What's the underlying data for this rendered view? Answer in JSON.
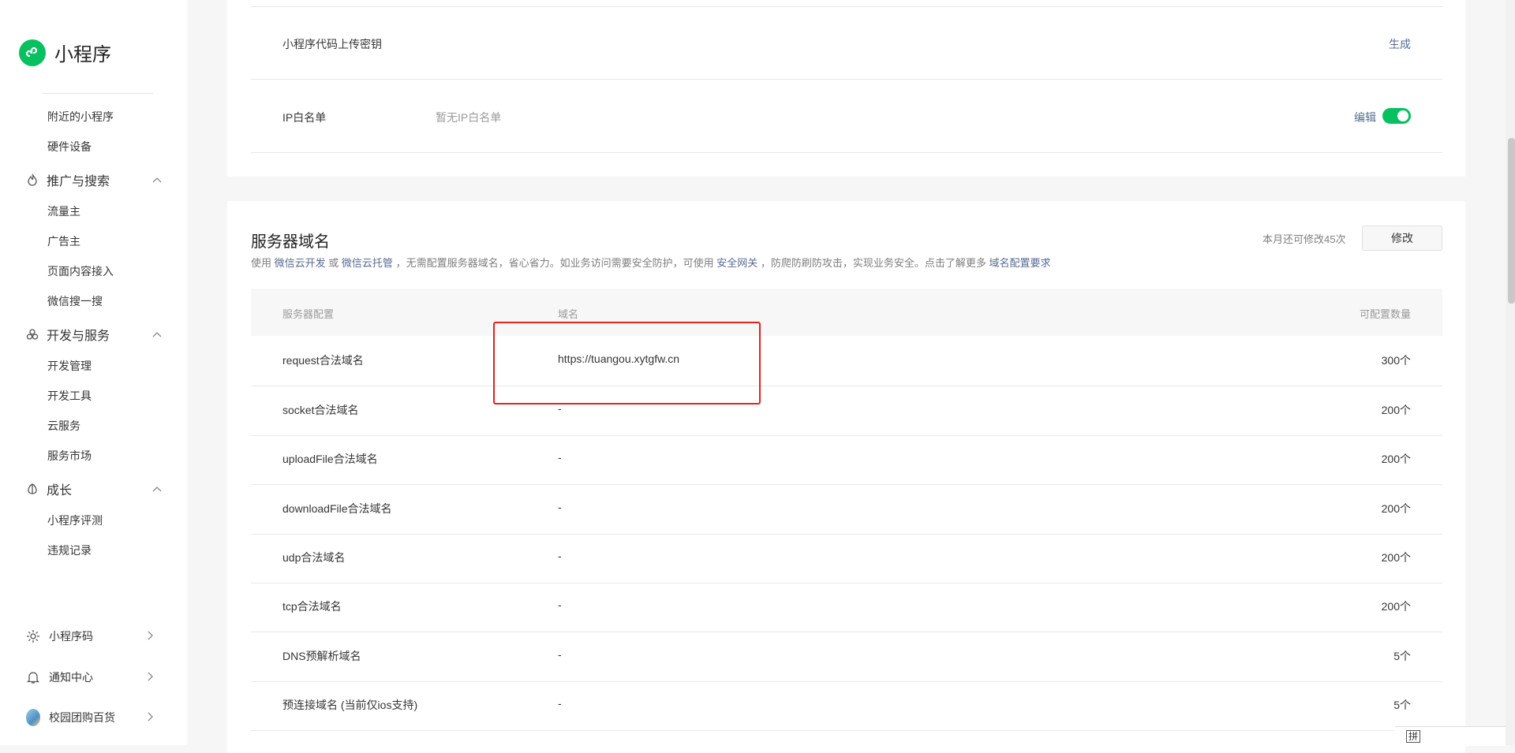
{
  "app": {
    "title": "小程序"
  },
  "sidebar": {
    "items": [
      {
        "label": "附近的小程序"
      },
      {
        "label": "硬件设备"
      },
      {
        "label": "推广与搜索"
      },
      {
        "label": "流量主"
      },
      {
        "label": "广告主"
      },
      {
        "label": "页面内容接入"
      },
      {
        "label": "微信搜一搜"
      },
      {
        "label": "开发与服务"
      },
      {
        "label": "开发管理"
      },
      {
        "label": "开发工具"
      },
      {
        "label": "云服务"
      },
      {
        "label": "服务市场"
      },
      {
        "label": "成长"
      },
      {
        "label": "小程序评测"
      },
      {
        "label": "违规记录"
      }
    ],
    "bottom": [
      {
        "label": "小程序码",
        "icon": "sun-icon"
      },
      {
        "label": "通知中心",
        "icon": "bell-icon"
      },
      {
        "label": "校园团购百货",
        "icon": "avatar"
      }
    ]
  },
  "top_card": {
    "upload_key": {
      "label": "小程序代码上传密钥",
      "action": "生成"
    },
    "ip_whitelist": {
      "label": "IP白名单",
      "note": "暂无IP白名单",
      "action": "编辑",
      "enabled": true
    }
  },
  "server_domain": {
    "title": "服务器域名",
    "desc": {
      "p1": "使用",
      "link1": "微信云开发",
      "p2": "或",
      "link2": "微信云托管",
      "p3": "，无需配置服务器域名，省心省力。如业务访问需要安全防护，可使用",
      "link3": "安全网关",
      "p4": "，防爬防刷防攻击，实现业务安全。点击了解更多",
      "link4": "域名配置要求"
    },
    "quota": "本月还可修改45次",
    "modify_label": "修改",
    "headers": [
      "服务器配置",
      "域名",
      "可配置数量"
    ],
    "rows": [
      {
        "config": "request合法域名",
        "domain": "https://tuangou.xytgfw.cn",
        "count": "300个"
      },
      {
        "config": "socket合法域名",
        "domain": "-",
        "count": "200个"
      },
      {
        "config": "uploadFile合法域名",
        "domain": "-",
        "count": "200个"
      },
      {
        "config": "downloadFile合法域名",
        "domain": "-",
        "count": "200个"
      },
      {
        "config": "udp合法域名",
        "domain": "-",
        "count": "200个"
      },
      {
        "config": "tcp合法域名",
        "domain": "-",
        "count": "200个"
      },
      {
        "config": "DNS预解析域名",
        "domain": "-",
        "count": "5个"
      },
      {
        "config": "预连接域名 (当前仅ios支持)",
        "domain": "-",
        "count": "5个"
      }
    ]
  },
  "ime": {
    "label": "拼"
  },
  "colors": {
    "accent": "#07c160",
    "link": "#576b95",
    "highlight": "#e6201b"
  }
}
